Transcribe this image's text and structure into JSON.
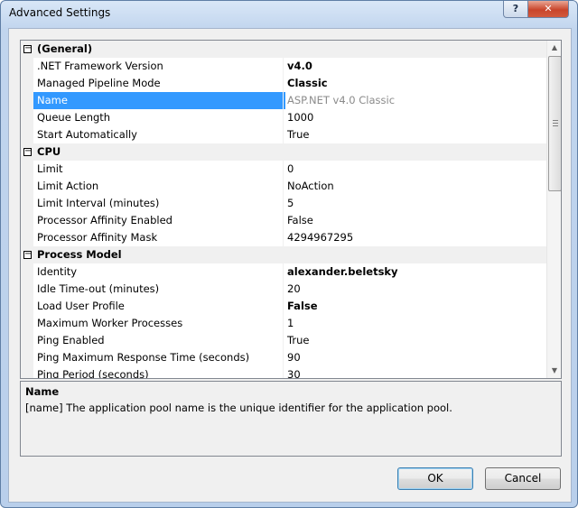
{
  "window": {
    "title": "Advanced Settings",
    "help_label": "?",
    "close_label": "✕"
  },
  "property_grid": {
    "categories": [
      {
        "name": "(General)",
        "toggle": "−",
        "properties": [
          {
            "name": ".NET Framework Version",
            "value": "v4.0",
            "bold": true
          },
          {
            "name": "Managed Pipeline Mode",
            "value": "Classic",
            "bold": true
          },
          {
            "name": "Name",
            "value": "ASP.NET v4.0 Classic",
            "selected": true,
            "disabled": true
          },
          {
            "name": "Queue Length",
            "value": "1000"
          },
          {
            "name": "Start Automatically",
            "value": "True"
          }
        ]
      },
      {
        "name": "CPU",
        "toggle": "−",
        "properties": [
          {
            "name": "Limit",
            "value": "0"
          },
          {
            "name": "Limit Action",
            "value": "NoAction"
          },
          {
            "name": "Limit Interval (minutes)",
            "value": "5"
          },
          {
            "name": "Processor Affinity Enabled",
            "value": "False"
          },
          {
            "name": "Processor Affinity Mask",
            "value": "4294967295"
          }
        ]
      },
      {
        "name": "Process Model",
        "toggle": "−",
        "properties": [
          {
            "name": "Identity",
            "value": "alexander.beletsky",
            "bold": true
          },
          {
            "name": "Idle Time-out (minutes)",
            "value": "20"
          },
          {
            "name": "Load User Profile",
            "value": "False",
            "bold": true
          },
          {
            "name": "Maximum Worker Processes",
            "value": "1"
          },
          {
            "name": "Ping Enabled",
            "value": "True"
          },
          {
            "name": "Ping Maximum Response Time (seconds)",
            "value": "90"
          },
          {
            "name": "Ping Period (seconds)",
            "value": "30"
          }
        ]
      }
    ],
    "scrollbar": {
      "up_icon": "▲",
      "down_icon": "▼"
    }
  },
  "description": {
    "title": "Name",
    "text": "[name] The application pool name is the unique identifier for the application pool."
  },
  "buttons": {
    "ok_label": "OK",
    "cancel_label": "Cancel"
  }
}
